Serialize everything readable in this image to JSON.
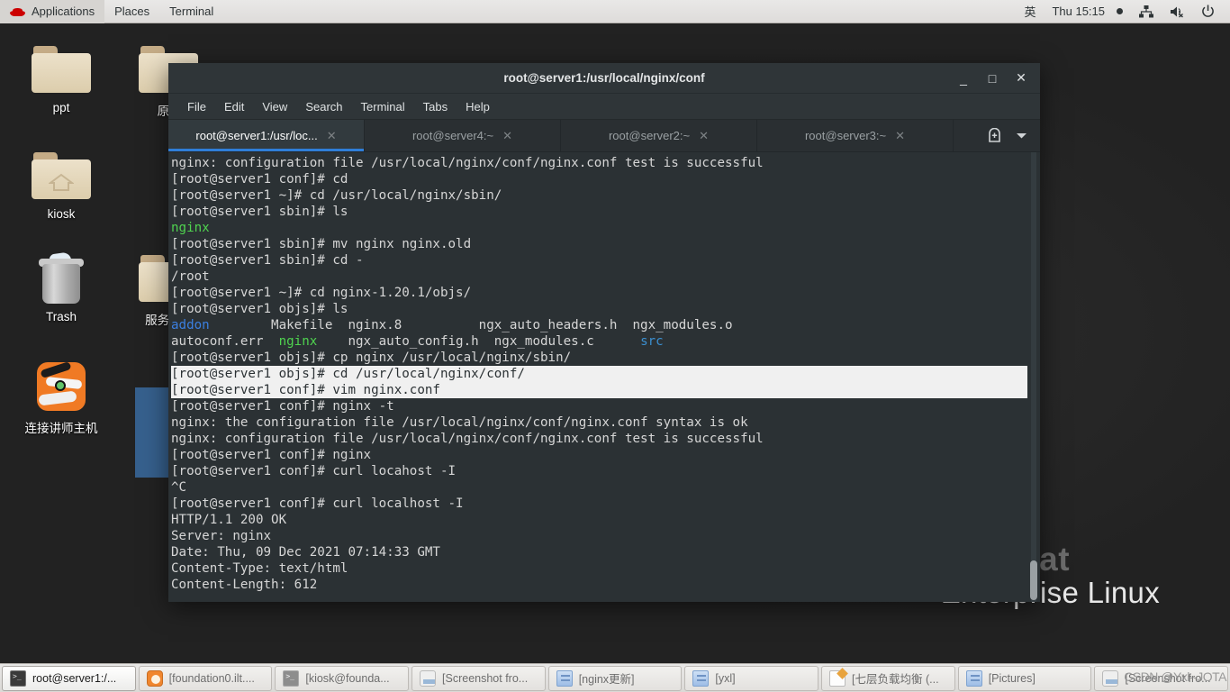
{
  "top_panel": {
    "logo_icon": "redhat-icon",
    "menus": [
      "Applications",
      "Places",
      "Terminal"
    ],
    "input_method": "英",
    "clock": "Thu 15:15",
    "tray_icons": [
      "network-icon",
      "volume-muted-icon",
      "power-icon"
    ]
  },
  "desktop": {
    "icons": [
      {
        "label": "ppt",
        "icon": "folder-icon"
      },
      {
        "label": "kiosk",
        "icon": "folder-home-icon"
      },
      {
        "label": "Trash",
        "icon": "trash-icon"
      },
      {
        "label": "连接讲师主机",
        "icon": "vnc-tiger-icon"
      },
      {
        "label": "原...",
        "icon": "folder-icon"
      },
      {
        "label": "服务器...",
        "icon": "folder-icon"
      }
    ],
    "watermark": {
      "line1": "Red Hat",
      "line2": "Enterprise Linux"
    }
  },
  "terminal": {
    "title": "root@server1:/usr/local/nginx/conf",
    "window_buttons": {
      "minimize": "_",
      "maximize": "□",
      "close": "✕"
    },
    "menu": [
      "File",
      "Edit",
      "View",
      "Search",
      "Terminal",
      "Tabs",
      "Help"
    ],
    "tabs": [
      {
        "label": "root@server1:/usr/loc...",
        "active": true,
        "close": "✕"
      },
      {
        "label": "root@server4:~",
        "active": false,
        "close": "✕"
      },
      {
        "label": "root@server2:~",
        "active": false,
        "close": "✕"
      },
      {
        "label": "root@server3:~",
        "active": false,
        "close": "✕"
      }
    ],
    "new_tab_icon": "new-tab-icon",
    "tab_menu_icon": "chevron-down-icon",
    "lines": [
      {
        "segments": [
          {
            "t": "nginx: configuration file /usr/local/nginx/conf/nginx.conf test is successful"
          }
        ]
      },
      {
        "segments": [
          {
            "t": "[root@server1 conf]# cd"
          }
        ]
      },
      {
        "segments": [
          {
            "t": "[root@server1 ~]# cd /usr/local/nginx/sbin/"
          }
        ]
      },
      {
        "segments": [
          {
            "t": "[root@server1 sbin]# ls"
          }
        ]
      },
      {
        "segments": [
          {
            "t": "nginx",
            "c": "green"
          }
        ]
      },
      {
        "segments": [
          {
            "t": "[root@server1 sbin]# mv nginx nginx.old"
          }
        ]
      },
      {
        "segments": [
          {
            "t": "[root@server1 sbin]# cd -"
          }
        ]
      },
      {
        "segments": [
          {
            "t": "/root"
          }
        ]
      },
      {
        "segments": [
          {
            "t": "[root@server1 ~]# cd nginx-1.20.1/objs/"
          }
        ]
      },
      {
        "segments": [
          {
            "t": "[root@server1 objs]# ls"
          }
        ]
      },
      {
        "segments": [
          {
            "t": "addon",
            "c": "blue"
          },
          {
            "t": "        Makefile  nginx.8          ngx_auto_headers.h  ngx_modules.o"
          }
        ]
      },
      {
        "segments": [
          {
            "t": "autoconf.err  "
          },
          {
            "t": "nginx",
            "c": "green"
          },
          {
            "t": "    ngx_auto_config.h  ngx_modules.c      "
          },
          {
            "t": "src",
            "c": "cyan"
          }
        ]
      },
      {
        "segments": [
          {
            "t": "[root@server1 objs]# cp nginx /usr/local/nginx/sbin/"
          }
        ]
      },
      {
        "hl": true,
        "segments": [
          {
            "t": "[root@server1 objs]# cd /usr/local/nginx/conf/"
          }
        ]
      },
      {
        "hl": true,
        "segments": [
          {
            "t": "[root@server1 conf]# vim nginx.conf"
          }
        ]
      },
      {
        "segments": [
          {
            "t": "[root@server1 conf]# nginx -t"
          }
        ]
      },
      {
        "segments": [
          {
            "t": "nginx: the configuration file /usr/local/nginx/conf/nginx.conf syntax is ok"
          }
        ]
      },
      {
        "segments": [
          {
            "t": "nginx: configuration file /usr/local/nginx/conf/nginx.conf test is successful"
          }
        ]
      },
      {
        "segments": [
          {
            "t": "[root@server1 conf]# nginx"
          }
        ]
      },
      {
        "segments": [
          {
            "t": "[root@server1 conf]# curl locahost -I"
          }
        ]
      },
      {
        "segments": [
          {
            "t": "^C"
          }
        ]
      },
      {
        "segments": [
          {
            "t": "[root@server1 conf]# curl localhost -I"
          }
        ]
      },
      {
        "segments": [
          {
            "t": "HTTP/1.1 200 OK"
          }
        ]
      },
      {
        "segments": [
          {
            "t": "Server: nginx"
          }
        ]
      },
      {
        "segments": [
          {
            "t": "Date: Thu, 09 Dec 2021 07:14:33 GMT"
          }
        ]
      },
      {
        "segments": [
          {
            "t": "Content-Type: text/html"
          }
        ]
      },
      {
        "segments": [
          {
            "t": "Content-Length: 612"
          }
        ]
      }
    ]
  },
  "taskbar": {
    "items": [
      {
        "label": "root@server1:/...",
        "icon": "terminal-icon",
        "active": true
      },
      {
        "label": "[foundation0.ilt....",
        "icon": "vnc-icon",
        "active": false
      },
      {
        "label": "[kiosk@founda...",
        "icon": "terminal-icon",
        "active": false
      },
      {
        "label": "[Screenshot fro...",
        "icon": "image-icon",
        "active": false
      },
      {
        "label": "[nginx更新]",
        "icon": "file-icon",
        "active": false
      },
      {
        "label": "[yxl]",
        "icon": "file-icon",
        "active": false
      },
      {
        "label": "[七层负载均衡 (...",
        "icon": "text-editor-icon",
        "active": false
      },
      {
        "label": "[Pictures]",
        "icon": "file-icon",
        "active": false
      },
      {
        "label": "[Screenshot fro...",
        "icon": "image-icon",
        "active": false
      }
    ],
    "watermark": "CSDN @Yxl--JOTA"
  },
  "colors": {
    "accent_tab": "#2f7ed8",
    "terminal_bg": "#2b3134",
    "panel_bg": "#e9e8e7",
    "selection": "#f0f0f0"
  }
}
